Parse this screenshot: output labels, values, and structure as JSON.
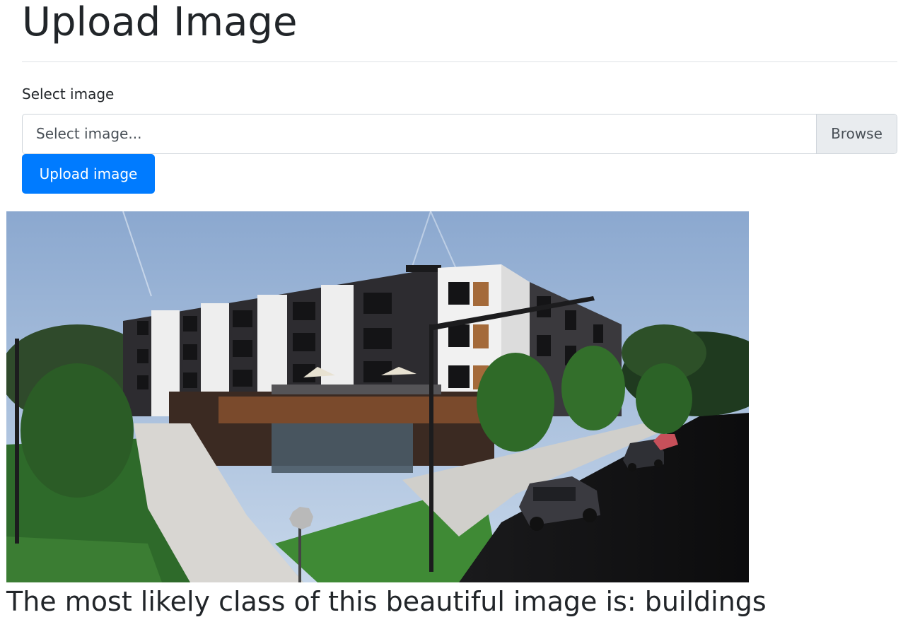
{
  "page": {
    "title": "Upload Image",
    "result_text": "The most likely class of this beautiful image is: buildings"
  },
  "form": {
    "label": "Select image",
    "file_placeholder": "Select image...",
    "browse_label": "Browse",
    "upload_button_label": "Upload image"
  },
  "image": {
    "subject": "rendering of a four-storey apartment building at a street corner with trees, lawns, street lamps and parked cars"
  },
  "colors": {
    "primary": "#007bff",
    "text": "#212529",
    "border": "#ced4da",
    "browse_bg": "#e9ecef"
  }
}
